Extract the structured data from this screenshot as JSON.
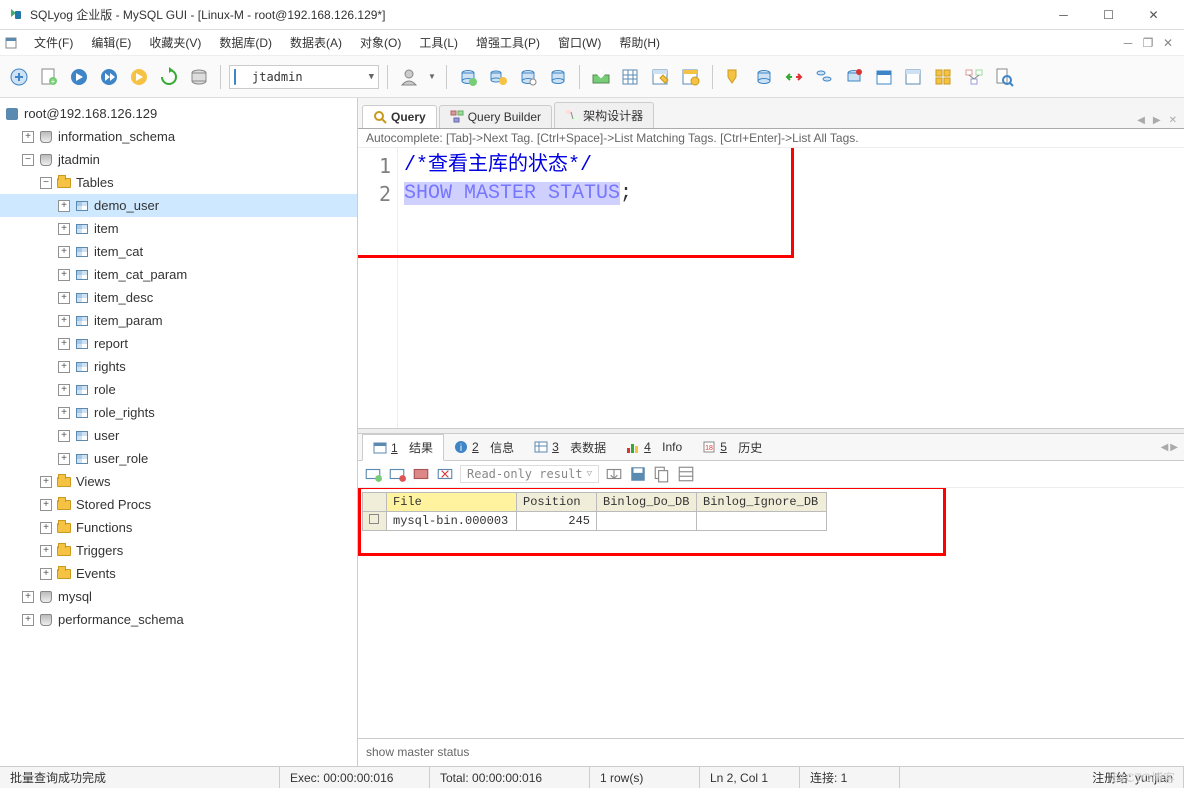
{
  "window": {
    "title": "SQLyog 企业版 - MySQL GUI - [Linux-M - root@192.168.126.129*]"
  },
  "menu": {
    "file": "文件(F)",
    "edit": "编辑(E)",
    "favorites": "收藏夹(V)",
    "database": "数据库(D)",
    "table": "数据表(A)",
    "objects": "对象(O)",
    "tools": "工具(L)",
    "powertools": "增强工具(P)",
    "window": "窗口(W)",
    "help": "帮助(H)"
  },
  "toolbar": {
    "db_selected": "jtadmin"
  },
  "tree": {
    "root": "root@192.168.126.129",
    "dbs": [
      {
        "name": "information_schema",
        "expanded": false
      },
      {
        "name": "jtadmin",
        "expanded": true,
        "children": [
          {
            "name": "Tables",
            "type": "folder",
            "expanded": true,
            "children": [
              {
                "name": "demo_user",
                "selected": true
              },
              {
                "name": "item"
              },
              {
                "name": "item_cat"
              },
              {
                "name": "item_cat_param"
              },
              {
                "name": "item_desc"
              },
              {
                "name": "item_param"
              },
              {
                "name": "report"
              },
              {
                "name": "rights"
              },
              {
                "name": "role"
              },
              {
                "name": "role_rights"
              },
              {
                "name": "user"
              },
              {
                "name": "user_role"
              }
            ]
          },
          {
            "name": "Views",
            "type": "folder"
          },
          {
            "name": "Stored Procs",
            "type": "folder"
          },
          {
            "name": "Functions",
            "type": "folder"
          },
          {
            "name": "Triggers",
            "type": "folder"
          },
          {
            "name": "Events",
            "type": "folder"
          }
        ]
      },
      {
        "name": "mysql",
        "expanded": false
      },
      {
        "name": "performance_schema",
        "expanded": false
      }
    ]
  },
  "editor_tabs": {
    "query": "Query",
    "builder": "Query Builder",
    "schema": "架构设计器"
  },
  "autocomplete_hint": "Autocomplete: [Tab]->Next Tag. [Ctrl+Space]->List Matching Tags. [Ctrl+Enter]->List All Tags.",
  "sql": {
    "line1_comment": "/*查看主库的状态*/",
    "line2_stmt": "SHOW MASTER STATUS",
    "line2_semi": ";"
  },
  "result_tabs": {
    "t1": {
      "num": "1",
      "label": "结果"
    },
    "t2": {
      "num": "2",
      "label": "信息"
    },
    "t3": {
      "num": "3",
      "label": "表数据"
    },
    "t4": {
      "num": "4",
      "label": "Info"
    },
    "t5": {
      "num": "5",
      "label": "历史"
    }
  },
  "result_toolbar": {
    "readonly": "Read-only result"
  },
  "grid": {
    "headers": [
      "File",
      "Position",
      "Binlog_Do_DB",
      "Binlog_Ignore_DB"
    ],
    "rows": [
      {
        "File": "mysql-bin.000003",
        "Position": "245",
        "Binlog_Do_DB": "",
        "Binlog_Ignore_DB": ""
      }
    ]
  },
  "query_echo": "show master status",
  "status": {
    "msg": "批量查询成功完成",
    "exec": "Exec: 00:00:00:016",
    "total": "Total: 00:00:00:016",
    "rows": "1 row(s)",
    "pos": "Ln 2, Col 1",
    "conn": "连接: 1",
    "reg": "注册给: yunjian"
  },
  "watermark": "51CTO博客"
}
